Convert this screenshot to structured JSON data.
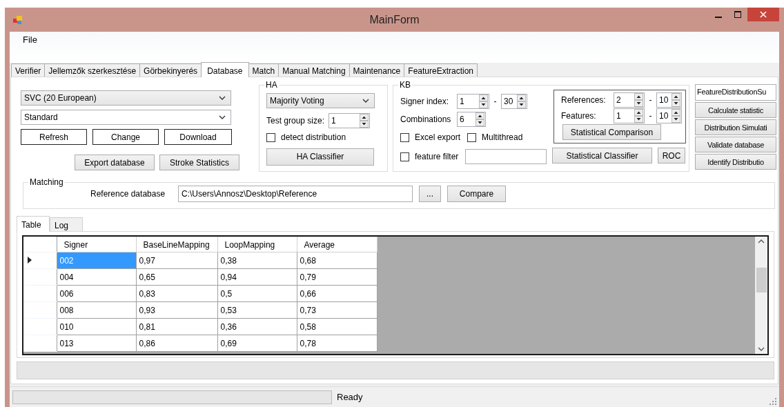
{
  "window": {
    "title": "MainForm"
  },
  "menu": [
    {
      "label": "File"
    }
  ],
  "tabs": [
    {
      "label": "Verifier",
      "selected": false
    },
    {
      "label": "Jellemzők szerkesztése",
      "selected": false
    },
    {
      "label": "Görbekinyerés",
      "selected": false
    },
    {
      "label": "Database",
      "selected": true
    },
    {
      "label": "Match",
      "selected": false
    },
    {
      "label": "Manual Matching",
      "selected": false
    },
    {
      "label": "Maintenance",
      "selected": false
    },
    {
      "label": "FeatureExtraction",
      "selected": false
    }
  ],
  "database": {
    "database_select": "SVC (20 European)",
    "mode_select": "Standard",
    "buttons": [
      "Refresh",
      "Change",
      "Download"
    ],
    "secondary_buttons": [
      "Export database",
      "Stroke Statistics"
    ]
  },
  "ha": {
    "title": "HA",
    "method": "Majority Voting",
    "test_group_label": "Test group size:",
    "test_group_size": "1",
    "detect_distribution": {
      "label": "detect distribution",
      "checked": false
    },
    "classifier_button": "HA Classifier"
  },
  "kb": {
    "title": "KB",
    "signer": {
      "label": "Signer index:",
      "from": "1",
      "separator": "-",
      "to": "30"
    },
    "combinations": {
      "label": "Combinations",
      "value": "6"
    },
    "options": [
      {
        "label": "Excel export",
        "checked": false
      },
      {
        "label": "Multithread",
        "checked": false
      }
    ],
    "feature_filter": {
      "label": "feature filter",
      "checked": false
    },
    "statistics": {
      "references": {
        "label": "References:",
        "from": "2",
        "separator": "-",
        "to": "10"
      },
      "features": {
        "label": "Features:",
        "from": "1",
        "separator": "-",
        "to": "10"
      },
      "comparison_button": "Statistical Comparison"
    },
    "classifier_button": "Statistical Classifier",
    "roc_button": "ROC"
  },
  "tools": {
    "field_value": "FeatureDistributionSu",
    "buttons": [
      "Calculate statistic",
      "Distribution Simulati",
      "Validate database",
      "Identify Distributio"
    ]
  },
  "matching": {
    "title": "Matching",
    "reference_label": "Reference database",
    "reference_path": "C:\\Users\\Annosz\\Desktop\\Reference",
    "browse_button": "...",
    "compare_button": "Compare"
  },
  "result_tabs": [
    {
      "label": "Table",
      "selected": true
    },
    {
      "label": "Log",
      "selected": false
    }
  ],
  "table": {
    "columns": [
      "Signer",
      "BaseLineMapping",
      "LoopMapping",
      "Average"
    ],
    "rows": [
      {
        "cells": [
          "002",
          "0,97",
          "0,38",
          "0,68"
        ],
        "selected": true
      },
      {
        "cells": [
          "004",
          "0,65",
          "0,94",
          "0,79"
        ],
        "selected": false
      },
      {
        "cells": [
          "006",
          "0,83",
          "0,5",
          "0,66"
        ],
        "selected": false
      },
      {
        "cells": [
          "008",
          "0,93",
          "0,53",
          "0,73"
        ],
        "selected": false
      },
      {
        "cells": [
          "010",
          "0,81",
          "0,36",
          "0,58"
        ],
        "selected": false
      },
      {
        "cells": [
          "013",
          "0,86",
          "0,69",
          "0,78"
        ],
        "selected": false
      }
    ]
  },
  "status_bar": {
    "progress": {
      "level": 0
    },
    "text": "Ready"
  }
}
